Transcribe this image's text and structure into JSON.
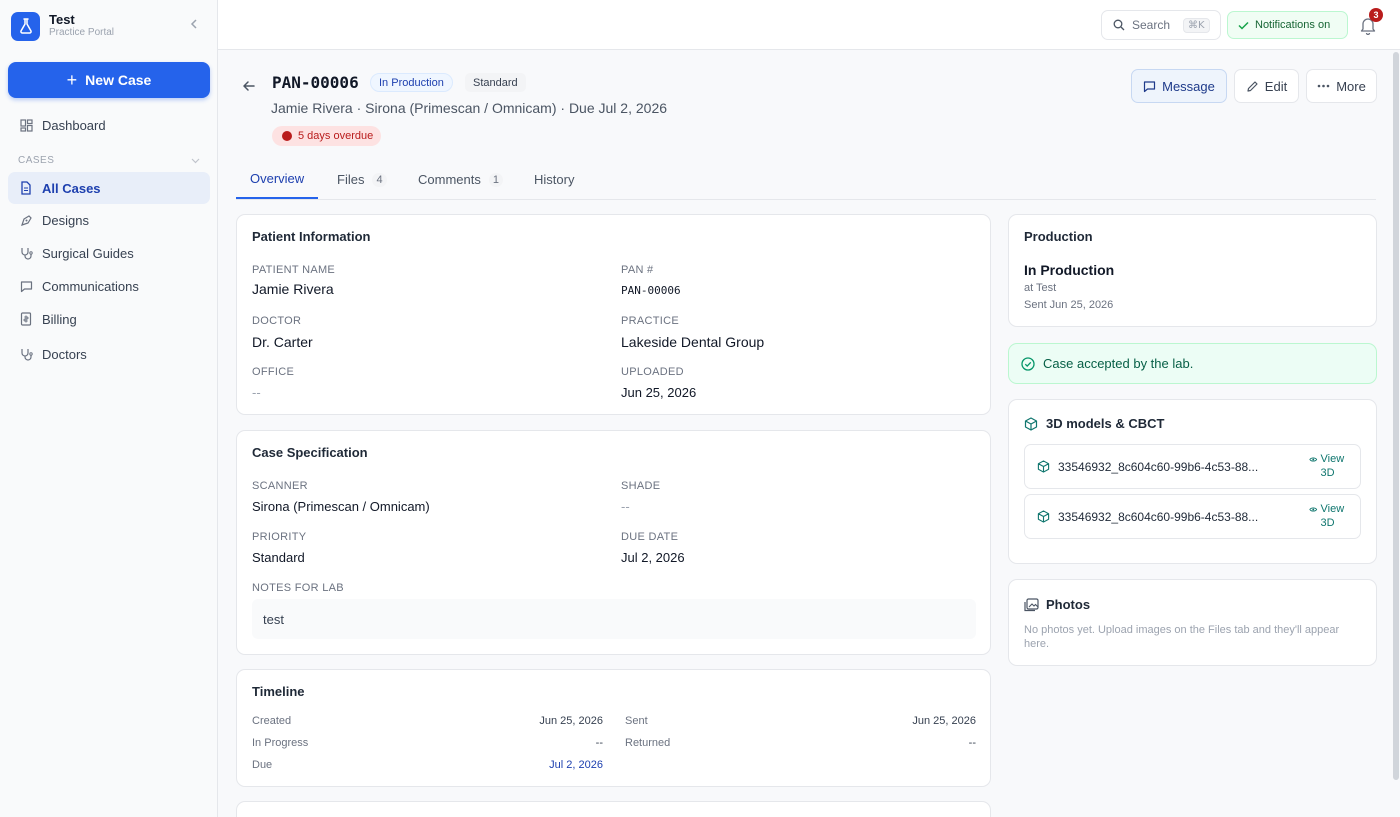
{
  "app": {
    "name": "Test",
    "subtitle": "Practice Portal"
  },
  "sidebar": {
    "new_case_label": "New Case",
    "dashboard_label": "Dashboard",
    "section_label": "CASES",
    "items": [
      {
        "label": "All Cases",
        "icon": "document-icon",
        "active": true
      },
      {
        "label": "Designs",
        "icon": "pen-tool-icon"
      },
      {
        "label": "Surgical Guides",
        "icon": "stethoscope-icon"
      },
      {
        "label": "Communications",
        "icon": "chat-icon"
      },
      {
        "label": "Billing",
        "icon": "receipt-icon"
      },
      {
        "label": "Doctors",
        "icon": "stethoscope-icon"
      }
    ]
  },
  "topbar": {
    "search_label": "Search",
    "search_shortcut": "⌘K",
    "notifications_label": "Notifications on",
    "notification_count": "3"
  },
  "case": {
    "id": "PAN-00006",
    "status": "In Production",
    "priority": "Standard",
    "subtitle": "Jamie Rivera · Sirona (Primescan / Omnicam) · Due Jul 2, 2026",
    "overdue": "5 days overdue"
  },
  "actions": {
    "message": "Message",
    "edit": "Edit",
    "more": "More"
  },
  "tabs": [
    {
      "label": "Overview",
      "count": ""
    },
    {
      "label": "Files",
      "count": "4"
    },
    {
      "label": "Comments",
      "count": "1"
    },
    {
      "label": "History",
      "count": ""
    }
  ],
  "patient": {
    "title": "Patient Information",
    "name_label": "PATIENT NAME",
    "name": "Jamie Rivera",
    "pan_label": "PAN #",
    "pan": "PAN-00006",
    "doctor_label": "DOCTOR",
    "doctor": "Dr. Carter",
    "practice_label": "PRACTICE",
    "practice": "Lakeside Dental Group",
    "office_label": "OFFICE",
    "office": "--",
    "uploaded_label": "UPLOADED",
    "uploaded": "Jun 25, 2026"
  },
  "spec": {
    "title": "Case Specification",
    "scanner_label": "SCANNER",
    "scanner": "Sirona (Primescan / Omnicam)",
    "shade_label": "SHADE",
    "shade": "--",
    "priority_label": "PRIORITY",
    "priority": "Standard",
    "due_label": "DUE DATE",
    "due": "Jul 2, 2026",
    "notes_label": "NOTES FOR LAB",
    "notes": "test"
  },
  "timeline": {
    "title": "Timeline",
    "created_label": "Created",
    "created": "Jun 25, 2026",
    "sent_label": "Sent",
    "sent": "Jun 25, 2026",
    "inprogress_label": "In Progress",
    "inprogress": "--",
    "returned_label": "Returned",
    "returned": "--",
    "due_label": "Due",
    "due": "Jul 2, 2026"
  },
  "production": {
    "title": "Production",
    "status": "In Production",
    "location": "at Test",
    "sent": "Sent Jun 25, 2026"
  },
  "accepted_message": "Case accepted by the lab.",
  "models": {
    "title": "3D models & CBCT",
    "files": [
      {
        "name": "33546932_8c604c60-99b6-4c53-88...",
        "action": "View 3D"
      },
      {
        "name": "33546932_8c604c60-99b6-4c53-88...",
        "action": "View 3D"
      }
    ]
  },
  "photos": {
    "title": "Photos",
    "empty_text": "No photos yet. Upload images on the Files tab and they'll appear here."
  },
  "colors": {
    "accent": "#2563eb",
    "success": "#065f46",
    "danger": "#b91c1c"
  }
}
